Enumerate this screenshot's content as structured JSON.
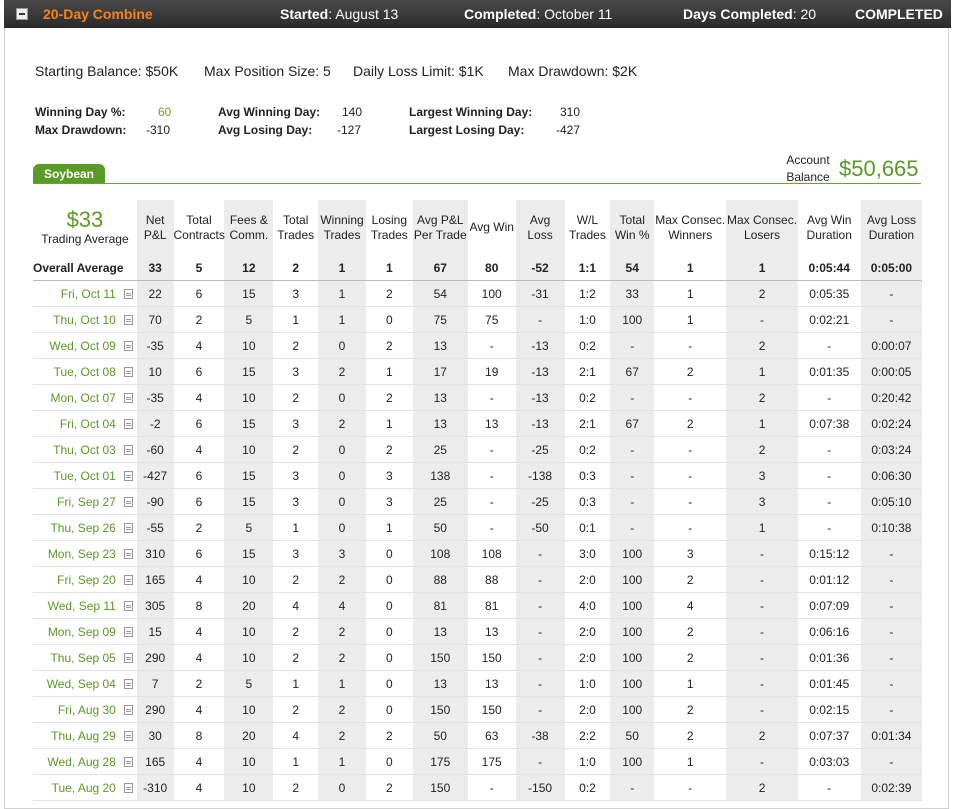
{
  "header": {
    "title": "20-Day Combine",
    "started_label": "Started",
    "started_value": "August 13",
    "completed_label": "Completed",
    "completed_value": "October 11",
    "days_label": "Days Completed",
    "days_value": "20",
    "status": "COMPLETED"
  },
  "summary": {
    "starting_balance": "Starting Balance: $50K",
    "max_position": "Max Position Size: 5",
    "daily_loss": "Daily Loss Limit: $1K",
    "max_drawdown": "Max Drawdown: $2K"
  },
  "stats": {
    "winning_day_label": "Winning Day %:",
    "winning_day_value": "60",
    "max_drawdown_label": "Max Drawdown:",
    "max_drawdown_value": "-310",
    "avg_winning_label": "Avg Winning Day:",
    "avg_winning_value": "140",
    "avg_losing_label": "Avg Losing Day:",
    "avg_losing_value": "-127",
    "largest_winning_label": "Largest Winning Day:",
    "largest_winning_value": "310",
    "largest_losing_label": "Largest Losing Day:",
    "largest_losing_value": "-427"
  },
  "tab": {
    "label": "Soybean"
  },
  "account": {
    "label": "Account Balance",
    "value": "$50,665"
  },
  "table": {
    "trading_average_value": "$33",
    "trading_average_label": "Trading Average",
    "headers": [
      "Net P&L",
      "Total Contracts",
      "Fees & Comm.",
      "Total Trades",
      "Winning Trades",
      "Losing Trades",
      "Avg P&L Per Trade",
      "Avg Win",
      "Avg Loss",
      "W/L Trades",
      "Total Win %",
      "Max Consec. Winners",
      "Max Consec. Losers",
      "Avg Win Duration",
      "Avg Loss Duration"
    ],
    "overall": {
      "label": "Overall Average",
      "cells": [
        "33",
        "5",
        "12",
        "2",
        "1",
        "1",
        "67",
        "80",
        "-52",
        "1:1",
        "54",
        "1",
        "1",
        "0:05:44",
        "0:05:00"
      ]
    },
    "rows": [
      {
        "date": "Fri, Oct 11",
        "cells": [
          "22",
          "6",
          "15",
          "3",
          "1",
          "2",
          "54",
          "100",
          "-31",
          "1:2",
          "33",
          "1",
          "2",
          "0:05:35",
          "-"
        ]
      },
      {
        "date": "Thu, Oct 10",
        "cells": [
          "70",
          "2",
          "5",
          "1",
          "1",
          "0",
          "75",
          "75",
          "-",
          "1:0",
          "100",
          "1",
          "-",
          "0:02:21",
          "-"
        ]
      },
      {
        "date": "Wed, Oct 09",
        "cells": [
          "-35",
          "4",
          "10",
          "2",
          "0",
          "2",
          "13",
          "-",
          "-13",
          "0:2",
          "-",
          "-",
          "2",
          "-",
          "0:00:07"
        ]
      },
      {
        "date": "Tue, Oct 08",
        "cells": [
          "10",
          "6",
          "15",
          "3",
          "2",
          "1",
          "17",
          "19",
          "-13",
          "2:1",
          "67",
          "2",
          "1",
          "0:01:35",
          "0:00:05"
        ]
      },
      {
        "date": "Mon, Oct 07",
        "cells": [
          "-35",
          "4",
          "10",
          "2",
          "0",
          "2",
          "13",
          "-",
          "-13",
          "0:2",
          "-",
          "-",
          "2",
          "-",
          "0:20:42"
        ]
      },
      {
        "date": "Fri, Oct 04",
        "cells": [
          "-2",
          "6",
          "15",
          "3",
          "2",
          "1",
          "13",
          "13",
          "-13",
          "2:1",
          "67",
          "2",
          "1",
          "0:07:38",
          "0:02:24"
        ]
      },
      {
        "date": "Thu, Oct 03",
        "cells": [
          "-60",
          "4",
          "10",
          "2",
          "0",
          "2",
          "25",
          "-",
          "-25",
          "0:2",
          "-",
          "-",
          "2",
          "-",
          "0:03:24"
        ]
      },
      {
        "date": "Tue, Oct 01",
        "cells": [
          "-427",
          "6",
          "15",
          "3",
          "0",
          "3",
          "138",
          "-",
          "-138",
          "0:3",
          "-",
          "-",
          "3",
          "-",
          "0:06:30"
        ]
      },
      {
        "date": "Fri, Sep 27",
        "cells": [
          "-90",
          "6",
          "15",
          "3",
          "0",
          "3",
          "25",
          "-",
          "-25",
          "0:3",
          "-",
          "-",
          "3",
          "-",
          "0:05:10"
        ]
      },
      {
        "date": "Thu, Sep 26",
        "cells": [
          "-55",
          "2",
          "5",
          "1",
          "0",
          "1",
          "50",
          "-",
          "-50",
          "0:1",
          "-",
          "-",
          "1",
          "-",
          "0:10:38"
        ]
      },
      {
        "date": "Mon, Sep 23",
        "cells": [
          "310",
          "6",
          "15",
          "3",
          "3",
          "0",
          "108",
          "108",
          "-",
          "3:0",
          "100",
          "3",
          "-",
          "0:15:12",
          "-"
        ]
      },
      {
        "date": "Fri, Sep 20",
        "cells": [
          "165",
          "4",
          "10",
          "2",
          "2",
          "0",
          "88",
          "88",
          "-",
          "2:0",
          "100",
          "2",
          "-",
          "0:01:12",
          "-"
        ]
      },
      {
        "date": "Wed, Sep 11",
        "cells": [
          "305",
          "8",
          "20",
          "4",
          "4",
          "0",
          "81",
          "81",
          "-",
          "4:0",
          "100",
          "4",
          "-",
          "0:07:09",
          "-"
        ]
      },
      {
        "date": "Mon, Sep 09",
        "cells": [
          "15",
          "4",
          "10",
          "2",
          "2",
          "0",
          "13",
          "13",
          "-",
          "2:0",
          "100",
          "2",
          "-",
          "0:06:16",
          "-"
        ]
      },
      {
        "date": "Thu, Sep 05",
        "cells": [
          "290",
          "4",
          "10",
          "2",
          "2",
          "0",
          "150",
          "150",
          "-",
          "2:0",
          "100",
          "2",
          "-",
          "0:01:36",
          "-"
        ]
      },
      {
        "date": "Wed, Sep 04",
        "cells": [
          "7",
          "2",
          "5",
          "1",
          "1",
          "0",
          "13",
          "13",
          "-",
          "1:0",
          "100",
          "1",
          "-",
          "0:01:45",
          "-"
        ]
      },
      {
        "date": "Fri, Aug 30",
        "cells": [
          "290",
          "4",
          "10",
          "2",
          "2",
          "0",
          "150",
          "150",
          "-",
          "2:0",
          "100",
          "2",
          "-",
          "0:02:15",
          "-"
        ]
      },
      {
        "date": "Thu, Aug 29",
        "cells": [
          "30",
          "8",
          "20",
          "4",
          "2",
          "2",
          "50",
          "63",
          "-38",
          "2:2",
          "50",
          "2",
          "2",
          "0:07:37",
          "0:01:34"
        ]
      },
      {
        "date": "Wed, Aug 28",
        "cells": [
          "165",
          "4",
          "10",
          "1",
          "1",
          "0",
          "175",
          "175",
          "-",
          "1:0",
          "100",
          "1",
          "-",
          "0:03:03",
          "-"
        ]
      },
      {
        "date": "Tue, Aug 20",
        "cells": [
          "-310",
          "4",
          "10",
          "2",
          "0",
          "2",
          "150",
          "-",
          "-150",
          "0:2",
          "-",
          "-",
          "2",
          "-",
          "0:02:39"
        ]
      }
    ]
  }
}
